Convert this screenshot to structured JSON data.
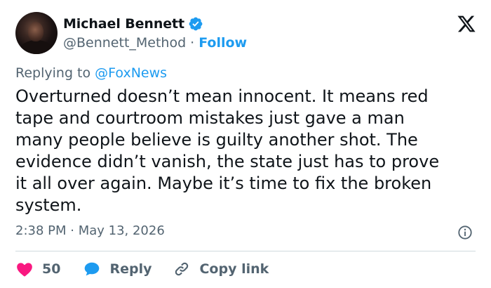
{
  "author": {
    "display_name": "Michael Bennett",
    "handle": "@Bennett_Method",
    "separator": "·",
    "follow_label": "Follow",
    "verified": true
  },
  "reply_context": {
    "prefix": "Replying to ",
    "mention": "@FoxNews"
  },
  "tweet": {
    "text": "Overturned doesn’t mean innocent. It means red\ntape and courtroom mistakes just gave a man\nmany people believe is guilty another shot. The\nevidence didn’t vanish, the state just has to prove\nit all over again. Maybe it’s time to fix the broken\nsystem."
  },
  "timestamp": "2:38 PM · May 13, 2026",
  "actions": {
    "like_count": "50",
    "reply_label": "Reply",
    "copy_link_label": "Copy link"
  },
  "colors": {
    "accent": "#1d9bf0",
    "like": "#f91880",
    "text": "#0f1419",
    "muted": "#536471",
    "divider": "#cfd9de"
  },
  "icons": {
    "verified": "verified-badge-icon",
    "platform": "x-logo-icon",
    "info": "info-icon",
    "like": "heart-icon",
    "reply": "speech-bubble-icon",
    "copy": "link-icon"
  }
}
